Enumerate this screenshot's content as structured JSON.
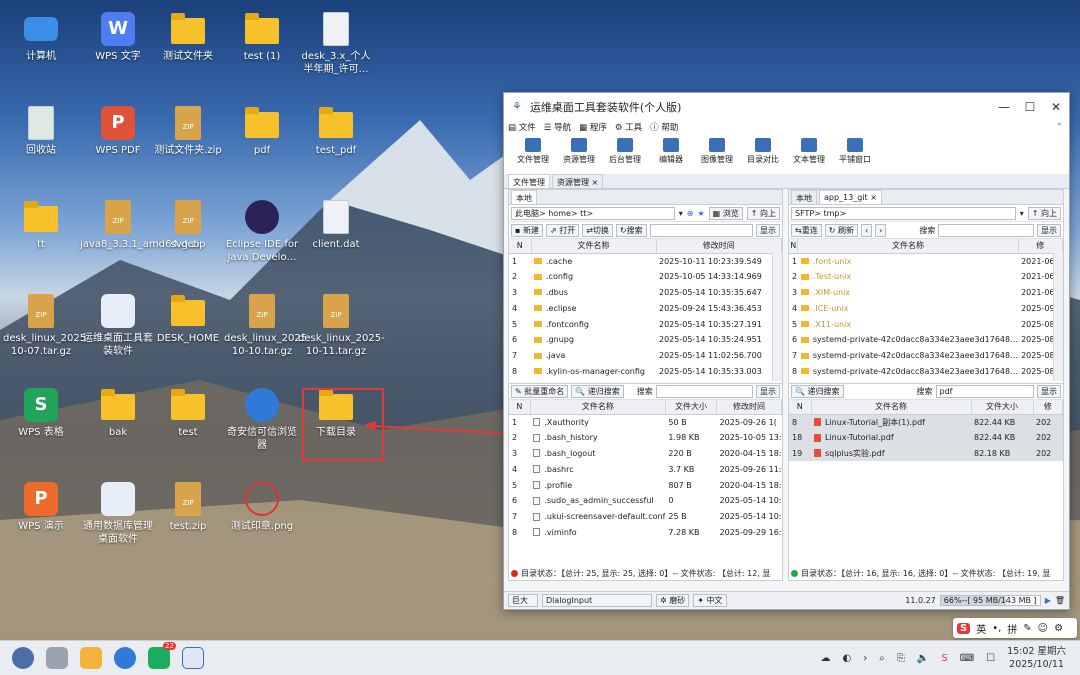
{
  "desktop_icons": [
    {
      "label": "计算机",
      "type": "monitor"
    },
    {
      "label": "WPS 文字",
      "type": "wps-w"
    },
    {
      "label": "测试文件夹",
      "type": "folder"
    },
    {
      "label": "test (1)",
      "type": "folder"
    },
    {
      "label": "desk_3.x_个人半年期_许可…",
      "type": "binary"
    },
    {
      "label": "回收站",
      "type": "trash"
    },
    {
      "label": "WPS PDF",
      "type": "wps-pdf"
    },
    {
      "label": "测试文件夹.zip",
      "type": "zip"
    },
    {
      "label": "pdf",
      "type": "folder"
    },
    {
      "label": "test_pdf",
      "type": "folder"
    },
    {
      "label": "tt",
      "type": "home-folder"
    },
    {
      "label": "java8_3.3.1_amd64.deb",
      "type": "deb"
    },
    {
      "label": "svg.zip",
      "type": "zip"
    },
    {
      "label": "Eclipse IDE for Java Develo…",
      "type": "eclipse"
    },
    {
      "label": "client.dat",
      "type": "doc"
    },
    {
      "label": "desk_linux_2025-10-07.tar.gz",
      "type": "gz"
    },
    {
      "label": "运维桌面工具套装软件",
      "type": "app"
    },
    {
      "label": "DESK_HOME",
      "type": "folder-link"
    },
    {
      "label": "desk_linux_2025-10-10.tar.gz",
      "type": "gz"
    },
    {
      "label": "desk_linux_2025-10-11.tar.gz",
      "type": "gz"
    },
    {
      "label": "WPS 表格",
      "type": "wps-s"
    },
    {
      "label": "bak",
      "type": "folder"
    },
    {
      "label": "test",
      "type": "folder"
    },
    {
      "label": "奇安信可信浏览器",
      "type": "browser"
    },
    {
      "label": "下载目录",
      "type": "folder"
    },
    {
      "label": "WPS 演示",
      "type": "wps-p"
    },
    {
      "label": "通用数据库管理桌面软件",
      "type": "dbapp"
    },
    {
      "label": "test.zip",
      "type": "zip"
    },
    {
      "label": "测试印章.png",
      "type": "stamp"
    }
  ],
  "window": {
    "title": "运维桌面工具套装软件(个人版)",
    "menu": [
      "文件",
      "导航",
      "程序",
      "工具",
      "帮助"
    ],
    "toolbar": [
      "文件管理",
      "资源管理",
      "后台管理",
      "编辑器",
      "图像管理",
      "目录对比",
      "文本管理",
      "平铺窗口"
    ],
    "tabs": [
      "文件管理",
      "资源管理 ×"
    ],
    "left": {
      "tab": "本地",
      "path": "此电脑> home> tt>",
      "btn_browse": "浏览",
      "btn_up": "向上",
      "btn_new": "新建",
      "btn_open": "打开",
      "btn_switch": "切换",
      "btn_search": "搜索",
      "btn_show": "显示",
      "col_n": "N",
      "col_name": "文件名称",
      "col_time": "修改时间",
      "dirs": [
        {
          "n": "1",
          "name": ".cache",
          "time": "2025-10-11 10:23:39.549"
        },
        {
          "n": "2",
          "name": ".config",
          "time": "2025-10-05 14:33:14.969"
        },
        {
          "n": "3",
          "name": ".dbus",
          "time": "2025-05-14 10:35:35.647"
        },
        {
          "n": "4",
          "name": ".eclipse",
          "time": "2025-09-24 15:43:36.453"
        },
        {
          "n": "5",
          "name": ".fontconfig",
          "time": "2025-05-14 10:35:27.191"
        },
        {
          "n": "6",
          "name": ".gnupg",
          "time": "2025-05-14 10:35:24.951"
        },
        {
          "n": "7",
          "name": ".java",
          "time": "2025-05-14 11:02:56.700"
        },
        {
          "n": "8",
          "name": ".kylin-os-manager-config",
          "time": "2025-05-14 10:35:33.003"
        },
        {
          "n": "9",
          "name": ".local",
          "time": "2025-05-14 10:35:22.991"
        }
      ],
      "btn_rename": "批量重命名",
      "btn_recursive": "递归搜索",
      "search_label": "搜索",
      "col_size": "文件大小",
      "files": [
        {
          "n": "1",
          "name": ".Xauthority",
          "size": "50 B",
          "time": "2025-09-26 1("
        },
        {
          "n": "2",
          "name": ".bash_history",
          "size": "1.98 KB",
          "time": "2025-10-05 13:"
        },
        {
          "n": "3",
          "name": ".bash_logout",
          "size": "220 B",
          "time": "2020-04-15 18:"
        },
        {
          "n": "4",
          "name": ".bashrc",
          "size": "3.7 KB",
          "time": "2025-09-26 11:"
        },
        {
          "n": "5",
          "name": ".profile",
          "size": "807 B",
          "time": "2020-04-15 18:"
        },
        {
          "n": "6",
          "name": ".sudo_as_admin_successful",
          "size": "0",
          "time": "2025-05-14 10:"
        },
        {
          "n": "7",
          "name": ".ukui-screensaver-default.conf",
          "size": "25 B",
          "time": "2025-05-14 10:"
        },
        {
          "n": "8",
          "name": ".viminfo",
          "size": "7.28 KB",
          "time": "2025-09-29 16:"
        }
      ],
      "status": "目录状态：【总计: 25, 显示: 25, 选择: 0】-- 文件状态: 【总计: 12, 显"
    },
    "right": {
      "tabs": [
        "本地",
        "app_13_git ×"
      ],
      "path": "SFTP> tmp>",
      "btn_up": "向上",
      "btn_reconnect": "重连",
      "btn_refresh": "刷新",
      "search_label": "搜索",
      "btn_show": "显示",
      "col_n": "N",
      "col_name": "文件名称",
      "col_time": "修",
      "dirs": [
        {
          "n": "1",
          "name": ".font-unix",
          "time": "2021-06-0",
          "dim": true
        },
        {
          "n": "2",
          "name": ".Test-unix",
          "time": "2021-06-0",
          "dim": true
        },
        {
          "n": "3",
          "name": ".XIM-unix",
          "time": "2021-06-0",
          "dim": true
        },
        {
          "n": "4",
          "name": ".ICE-unix",
          "time": "2025-09-2",
          "dim": true
        },
        {
          "n": "5",
          "name": ".X11-unix",
          "time": "2025-08-1",
          "dim": true
        },
        {
          "n": "6",
          "name": "systemd-private-42c0dacc8a334e23aee3d17648…",
          "time": "2025-08-1",
          "dim": false
        },
        {
          "n": "7",
          "name": "systemd-private-42c0dacc8a334e23aee3d17648…",
          "time": "2025-08-1",
          "dim": false
        },
        {
          "n": "8",
          "name": "systemd-private-42c0dacc8a334e23aee3d17648…",
          "time": "2025-08-1",
          "dim": false
        }
      ],
      "btn_recursive": "递归搜索",
      "search_value": "pdf",
      "col_size": "文件大小",
      "files": [
        {
          "n": "8",
          "name": "Linux-Tutorial_副本(1).pdf",
          "size": "822.44 KB",
          "time": "202"
        },
        {
          "n": "18",
          "name": "Linux-Tutorial.pdf",
          "size": "822.44 KB",
          "time": "202"
        },
        {
          "n": "19",
          "name": "sqlplus实验.pdf",
          "size": "82.18 KB",
          "time": "202"
        }
      ],
      "status": "目录状态：【总计: 16, 显示: 16, 选择: 0】-- 文件状态: 【总计: 19, 显"
    },
    "bottom": {
      "font_size": "巨大",
      "input_mode": "DialogInput",
      "style": "磨砂",
      "lang": "中文",
      "version": "11.0.27",
      "memory": "66%--[ 95 MB/143 MB ]"
    }
  },
  "ime": {
    "lang": "英",
    "mode": "拼"
  },
  "taskbar": {
    "notify_badge": "22",
    "time": "15:02 星期六",
    "date": "2025/10/11"
  },
  "colors": {
    "accent": "#3b6fb6",
    "folder": "#f6c12b",
    "highlight": "#e23a3a",
    "status_red": "#d9281f",
    "status_green": "#2ea043"
  }
}
